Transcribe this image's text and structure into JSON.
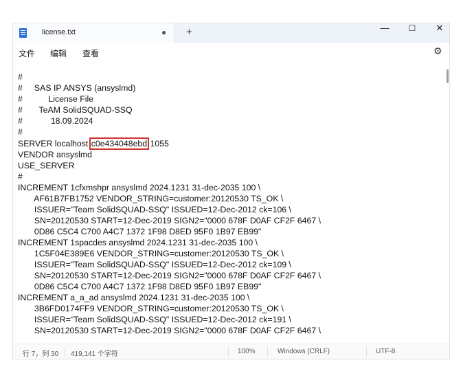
{
  "tab": {
    "title": "license.txt",
    "modified_dot": "●",
    "new_tab": "+"
  },
  "window_controls": {
    "minimize": "—",
    "maximize": "☐",
    "close": "✕"
  },
  "menu": {
    "file": "文件",
    "edit": "编辑",
    "view": "查看"
  },
  "icons": {
    "file": "notepad-file-icon",
    "settings": "gear-icon"
  },
  "editor": {
    "lines": [
      "#",
      "#     SAS IP ANSYS (ansyslmd)",
      "#           License File",
      "#       TeAM SolidSQUAD-SSQ",
      "#            18.09.2024",
      "#",
      "VENDOR ansyslmd",
      "USE_SERVER",
      "#",
      "INCREMENT 1cfxmshpr ansyslmd 2024.1231 31-dec-2035 100 \\",
      "       AF61B7FB1752 VENDOR_STRING=customer:20120530 TS_OK \\",
      "       ISSUER=\"Team SolidSQUAD-SSQ\" ISSUED=12-Dec-2012 ck=106 \\",
      "       SN=20120530 START=12-Dec-2019 SIGN2=\"0000 678F D0AF CF2F 6467 \\",
      "       0D86 C5C4 C700 A4C7 1372 1F98 D8ED 95F0 1B97 EB99\"",
      "INCREMENT 1spacdes ansyslmd 2024.1231 31-dec-2035 100 \\",
      "       1C5F04E389E6 VENDOR_STRING=customer:20120530 TS_OK \\",
      "       ISSUER=\"Team SolidSQUAD-SSQ\" ISSUED=12-Dec-2012 ck=109 \\",
      "       SN=20120530 START=12-Dec-2019 SIGN2=\"0000 678F D0AF CF2F 6467 \\",
      "       0D86 C5C4 C700 A4C7 1372 1F98 D8ED 95F0 1B97 EB99\"",
      "INCREMENT a_a_ad ansyslmd 2024.1231 31-dec-2035 100 \\",
      "       3B6FD0174FF9 VENDOR_STRING=customer:20120530 TS_OK \\",
      "       ISSUER=\"Team SolidSQUAD-SSQ\" ISSUED=12-Dec-2012 ck=191 \\",
      "       SN=20120530 START=12-Dec-2019 SIGN2=\"0000 678F D0AF CF2F 6467 \\"
    ],
    "server_line": {
      "prefix": "SERVER localhost ",
      "host_id": "c0e434048ebd",
      "suffix": " 1055"
    }
  },
  "status": {
    "position": "行 7，列 30",
    "char_count": "419,141 个字符",
    "zoom": "100%",
    "line_ending": "Windows (CRLF)",
    "encoding": "UTF-8"
  },
  "colors": {
    "highlight_box": "#d0312d",
    "titlebar": "#eef2f9"
  }
}
